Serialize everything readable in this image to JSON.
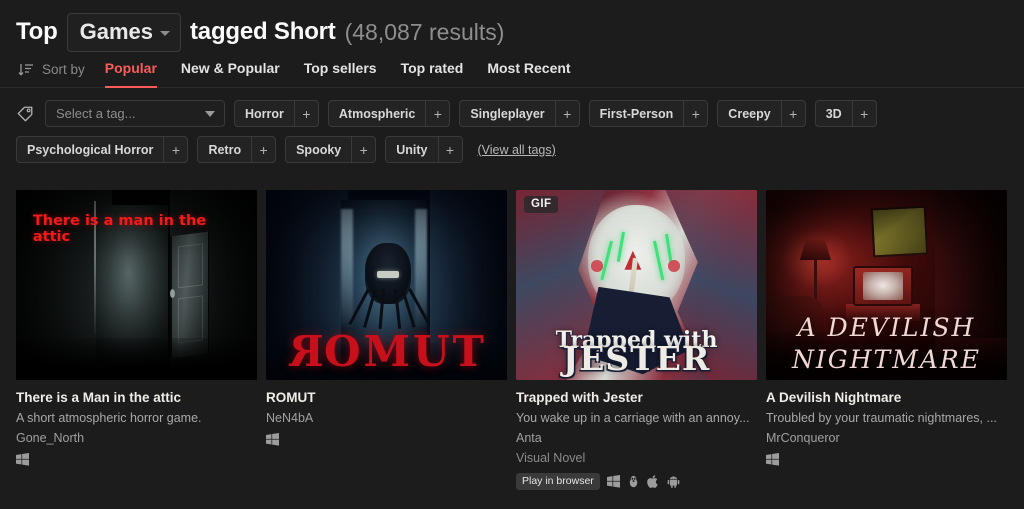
{
  "header": {
    "prefix": "Top",
    "type_selector": {
      "label": "Games",
      "icon": "chevron-down-icon"
    },
    "tagged_label": "tagged Short",
    "results_count": "(48,087 results)"
  },
  "sort_bar": {
    "icon": "sort-icon",
    "label": "Sort by",
    "options": [
      {
        "label": "Popular",
        "active": true
      },
      {
        "label": "New & Popular",
        "active": false
      },
      {
        "label": "Top sellers",
        "active": false
      },
      {
        "label": "Top rated",
        "active": false
      },
      {
        "label": "Most Recent",
        "active": false
      }
    ]
  },
  "tag_filter": {
    "icon": "tag-icon",
    "select_placeholder": "Select a tag...",
    "row1": [
      {
        "name": "Horror",
        "add": "+"
      },
      {
        "name": "Atmospheric",
        "add": "+"
      },
      {
        "name": "Singleplayer",
        "add": "+"
      },
      {
        "name": "First-Person",
        "add": "+"
      },
      {
        "name": "Creepy",
        "add": "+"
      },
      {
        "name": "3D",
        "add": "+"
      }
    ],
    "row2": [
      {
        "name": "Psychological Horror",
        "add": "+"
      },
      {
        "name": "Retro",
        "add": "+"
      },
      {
        "name": "Spooky",
        "add": "+"
      },
      {
        "name": "Unity",
        "add": "+"
      }
    ],
    "view_all": "(View all tags)"
  },
  "games": [
    {
      "title": "There is a Man in the attic",
      "description": "A short atmospheric horror game.",
      "author": "Gone_North",
      "genre": "",
      "browser_badge": "",
      "platforms": [
        "windows-icon"
      ],
      "art_text": "There is a man in the attic",
      "gif_badge": ""
    },
    {
      "title": "ROMUT",
      "description": "",
      "author": "NeN4bA",
      "genre": "",
      "browser_badge": "",
      "platforms": [
        "windows-icon"
      ],
      "art_text": "ROMUT",
      "gif_badge": ""
    },
    {
      "title": "Trapped with Jester",
      "description": "You wake up in a carriage with an annoy...",
      "author": "Anta",
      "genre": "Visual Novel",
      "browser_badge": "Play in browser",
      "platforms": [
        "windows-icon",
        "linux-icon",
        "apple-icon",
        "android-icon"
      ],
      "art_text": "Trapped with",
      "art_text2": "JESTER",
      "gif_badge": "GIF"
    },
    {
      "title": "A Devilish Nightmare",
      "description": "Troubled by your traumatic nightmares, ...",
      "author": "MrConqueror",
      "genre": "",
      "browser_badge": "",
      "platforms": [
        "windows-icon"
      ],
      "art_text": "A DEVILISH",
      "art_text2": "NIGHTMARE",
      "gif_badge": ""
    }
  ],
  "colors": {
    "background": "#1c1c1c",
    "accent_red": "#fa5c5c",
    "text_primary": "#f0ede8",
    "text_secondary": "#a8a8a8"
  }
}
